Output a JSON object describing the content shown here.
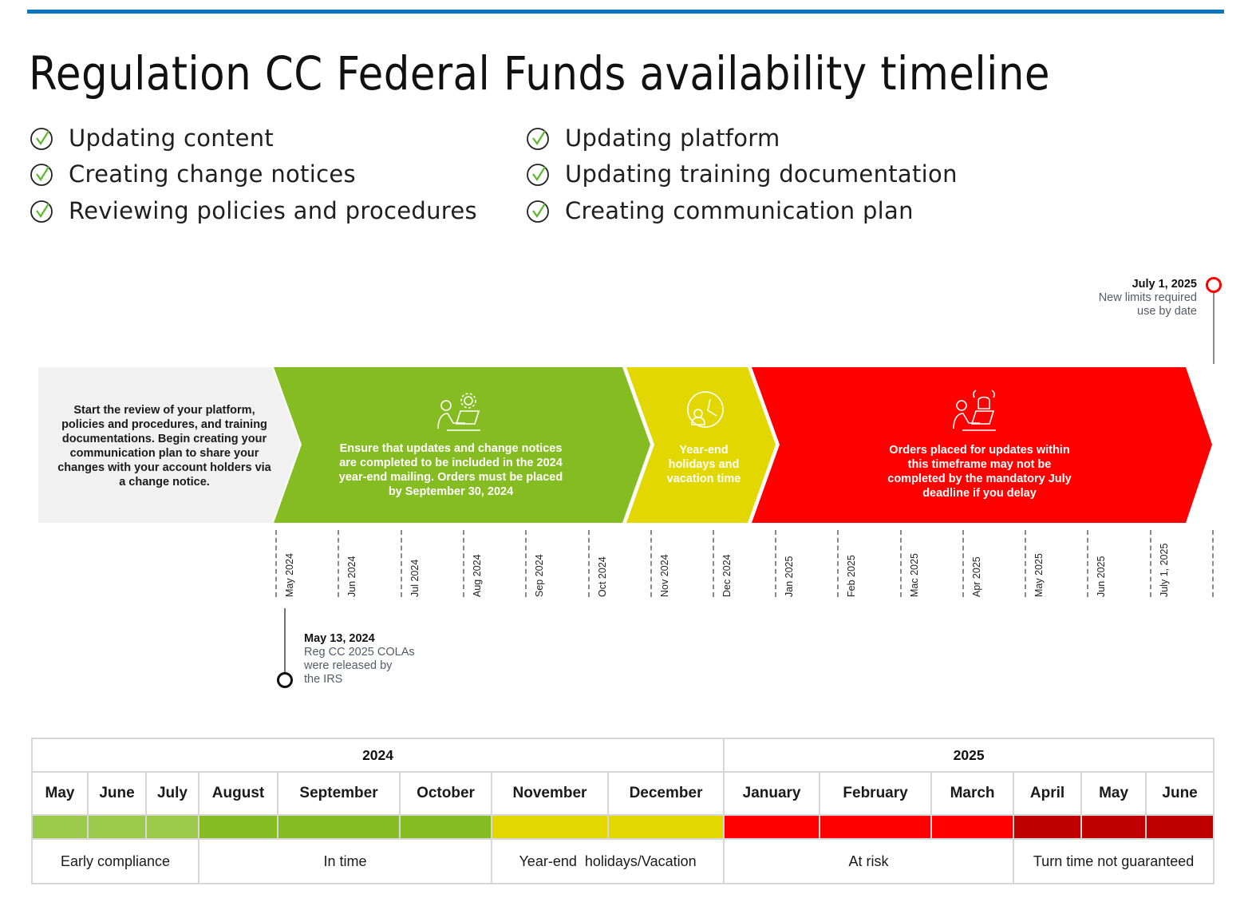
{
  "title": "Regulation CC Federal Funds availability timeline",
  "checklist": {
    "left": [
      "Updating content",
      "Creating change notices",
      "Reviewing policies and procedures"
    ],
    "right": [
      "Updating platform",
      "Updating training documentation",
      "Creating communication plan"
    ]
  },
  "colors": {
    "brand_blue": "#0a74c4",
    "gray_phase": "#f1f1f1",
    "green_phase": "#84bc22",
    "light_green": "#9bc94a",
    "yellow_phase": "#e3d700",
    "red_phase": "#ff0000",
    "dark_red": "#c00000",
    "check_green": "#5cb82c"
  },
  "phases": [
    {
      "id": "review",
      "text": "Start the review of your platform, policies and procedures, and training documentations. Begin creating your communication plan to share your changes with your account holders via a change notice.",
      "icon": "none"
    },
    {
      "id": "update",
      "text": "Ensure that updates and change notices are completed to be included in the 2024 year-end mailing. Orders must be placed by September 30, 2024",
      "icon": "person-laptop-gear-icon"
    },
    {
      "id": "holiday",
      "text": "Year-end holidays and vacation time",
      "icon": "person-clock-icon"
    },
    {
      "id": "risk",
      "text": "Orders placed for updates within this timeframe may not be completed by the mandatory July  deadline if you delay",
      "icon": "person-laptop-alarm-icon"
    }
  ],
  "milestones": {
    "end": {
      "date": "July 1, 2025",
      "desc_line1": "New limits required",
      "desc_line2": "use by date"
    },
    "start": {
      "date": "May 13, 2024",
      "desc_line1": "Reg CC 2025 COLAs",
      "desc_line2": "were released by",
      "desc_line3": "the IRS"
    }
  },
  "ticks": [
    "May 2024",
    "Jun 2024",
    "Jul 2024",
    "Aug 2024",
    "Sep 2024",
    "Oct 2024",
    "Nov 2024",
    "Dec 2024",
    "Jan 2025",
    "Feb 2025",
    "Mac 2025",
    "Apr 2025",
    "May 2025",
    "Jun 2025",
    "July 1, 2025"
  ],
  "legend": {
    "years": [
      {
        "label": "2024",
        "span": 8
      },
      {
        "label": "2025",
        "span": 6
      }
    ],
    "months": [
      "May",
      "June",
      "July",
      "August",
      "September",
      "October",
      "November",
      "December",
      "January",
      "February",
      "March",
      "April",
      "May",
      "June"
    ],
    "month_status": [
      "early",
      "early",
      "early",
      "intime",
      "intime",
      "intime",
      "holiday",
      "holiday",
      "risk",
      "risk",
      "risk",
      "notguaranteed",
      "notguaranteed",
      "notguaranteed"
    ],
    "statuses": [
      {
        "key": "early",
        "label": "Early compliance",
        "span": 3,
        "color": "#9bc94a"
      },
      {
        "key": "intime",
        "label": "In time",
        "span": 3,
        "color": "#84bc22"
      },
      {
        "key": "holiday",
        "label": "Year-end  holidays/Vacation",
        "span": 2,
        "color": "#e3d700"
      },
      {
        "key": "risk",
        "label": "At risk",
        "span": 3,
        "color": "#ff0000"
      },
      {
        "key": "notguaranteed",
        "label": "Turn time not guaranteed",
        "span": 3,
        "color": "#c00000"
      }
    ]
  }
}
